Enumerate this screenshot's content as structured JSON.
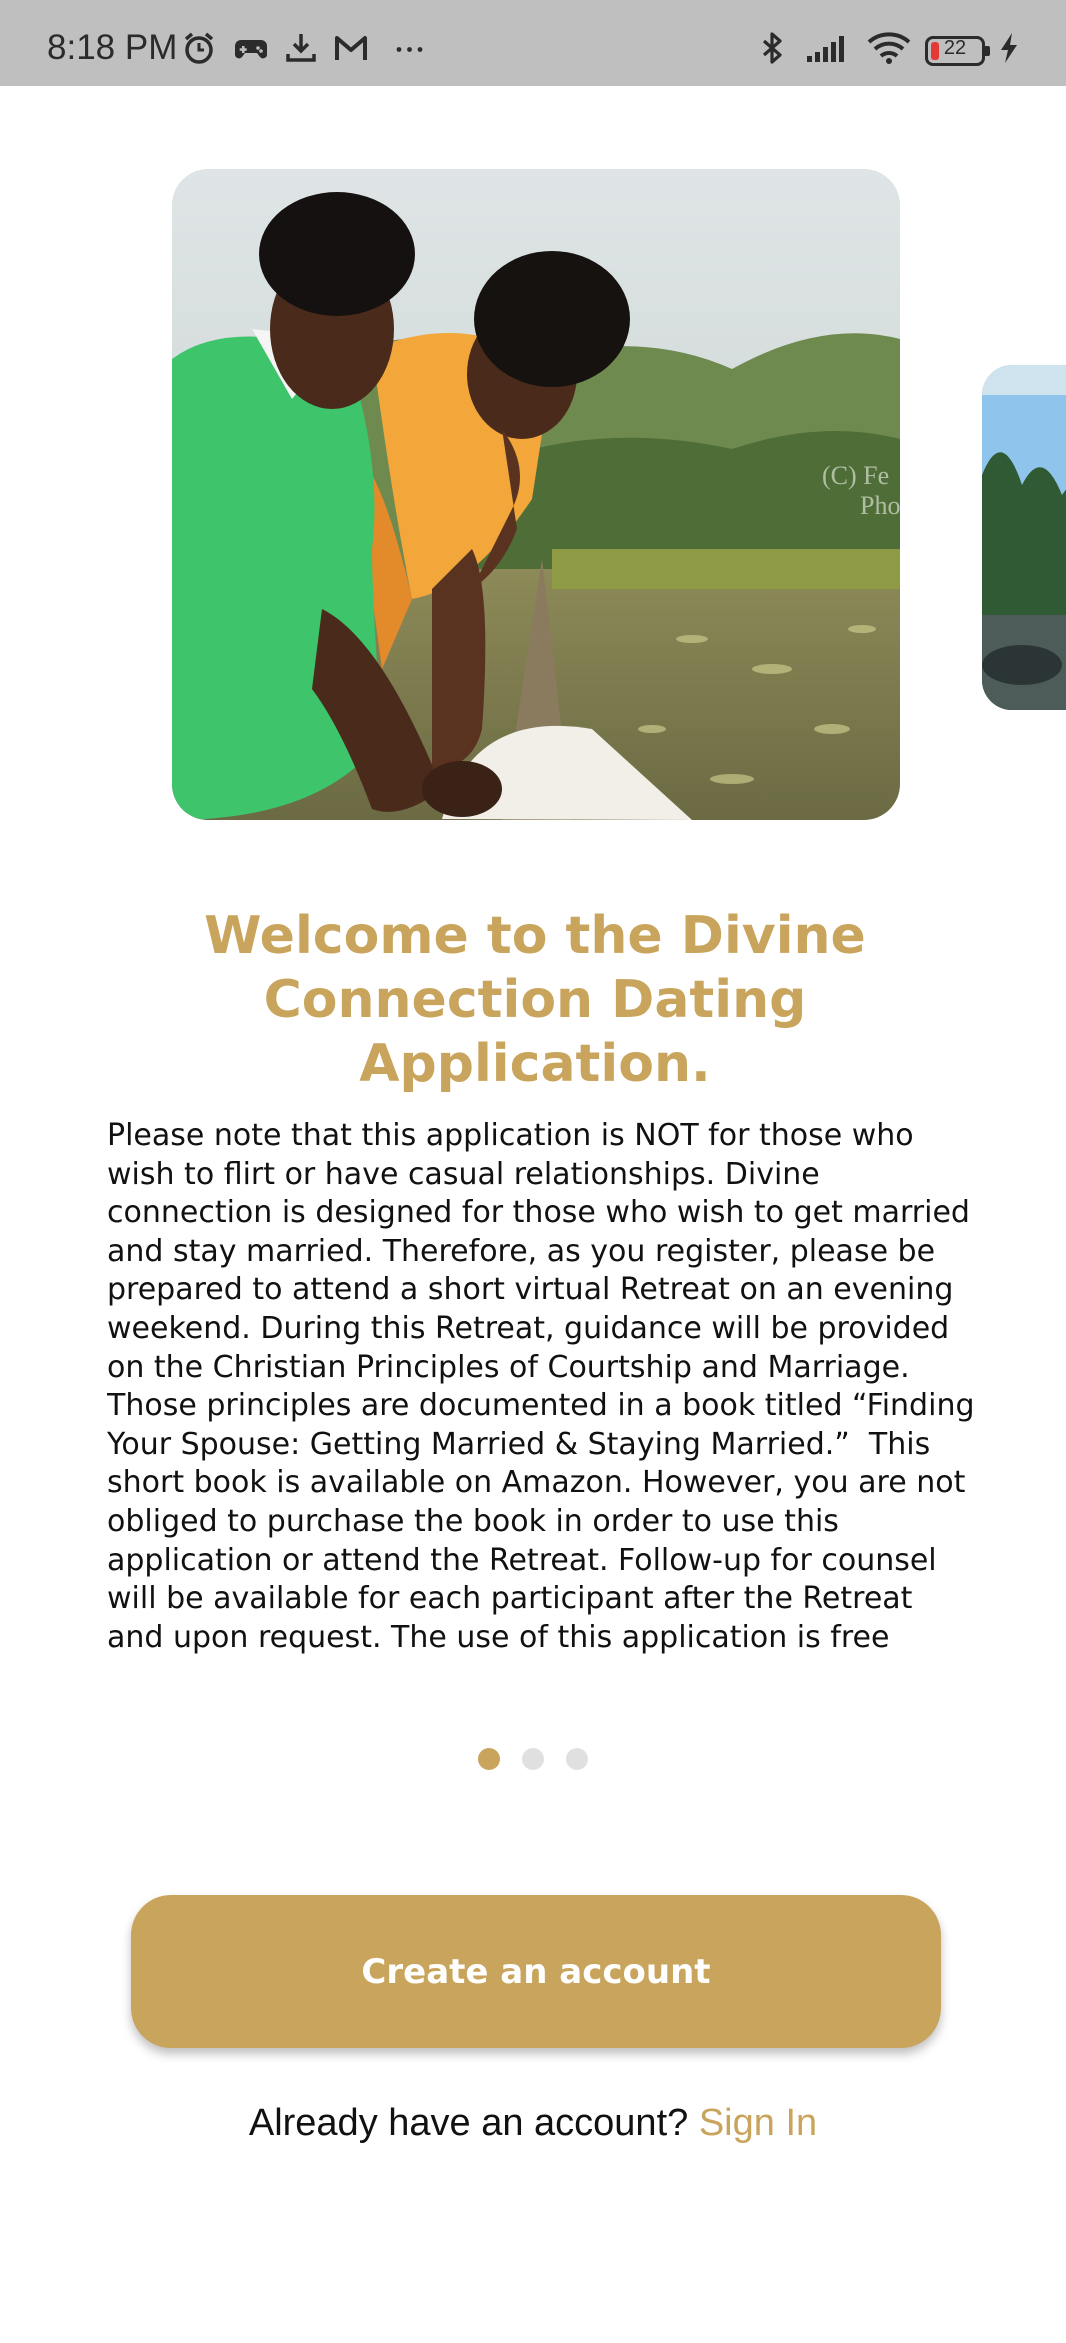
{
  "status_bar": {
    "time": "8:18 PM",
    "battery": "22",
    "icons": [
      "alarm-icon",
      "game-controller-icon",
      "download-icon",
      "gmail-icon",
      "more-dots-icon",
      "bluetooth-icon",
      "signal-icon",
      "wifi-icon",
      "battery-icon",
      "charging-icon"
    ]
  },
  "onboarding": {
    "title": "Welcome to the Divine Connection Dating Application.",
    "body": "Please note that this application is NOT for those who wish to flirt or have casual relationships. Divine connection is designed for those who wish to get married and stay married. Therefore, as you register, please be prepared to attend a short virtual Retreat on an evening weekend. During this Retreat, guidance will be provided on the Christian Principles of Courtship and Marriage. Those principles are documented in a book titled “Finding Your Spouse: Getting Married & Staying Married.”  This short book is available on Amazon. However, you are not obliged to purchase the book in order to use this application or attend the Retreat. Follow-up for counsel will be available for each participant after the Retreat and upon request. The use of this application is free although voluntary\ndonations are welcome",
    "hero_image": "couple-photo",
    "next_image": "next-slide-photo",
    "pages": 3,
    "current_page": 1
  },
  "actions": {
    "create_account_label": "Create an account",
    "signin_prompt": "Already have an account?",
    "signin_label": "Sign In"
  },
  "colors": {
    "accent": "#c9a45c",
    "status_bar": "#bfbfbf",
    "text": "#111111"
  }
}
